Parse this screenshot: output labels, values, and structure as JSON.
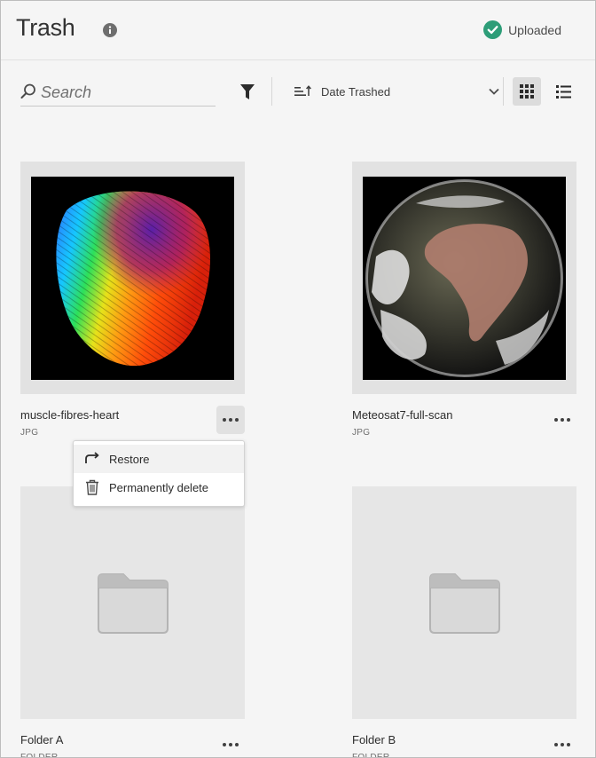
{
  "header": {
    "title": "Trash",
    "info_icon": "info-icon",
    "status": {
      "icon": "check-circle-icon",
      "label": "Uploaded",
      "color": "#2d9d78"
    }
  },
  "toolbar": {
    "search": {
      "placeholder": "Search",
      "value": ""
    },
    "filter_icon": "filter-icon",
    "sort": {
      "icon": "sort-order-icon",
      "label": "Date Trashed"
    },
    "view_modes": [
      {
        "name": "grid",
        "icon": "grid-view-icon",
        "selected": true
      },
      {
        "name": "list",
        "icon": "list-view-icon",
        "selected": false
      }
    ]
  },
  "items": [
    {
      "name": "muscle-fibres-heart",
      "type": "JPG"
    },
    {
      "name": "Meteosat7-full-scan",
      "type": "JPG"
    },
    {
      "name": "Folder A",
      "type": "FOLDER"
    },
    {
      "name": "Folder B",
      "type": "FOLDER"
    }
  ],
  "context_menu": {
    "items": [
      {
        "label": "Restore",
        "icon": "restore-icon"
      },
      {
        "label": "Permanently delete",
        "icon": "trash-icon"
      }
    ]
  }
}
